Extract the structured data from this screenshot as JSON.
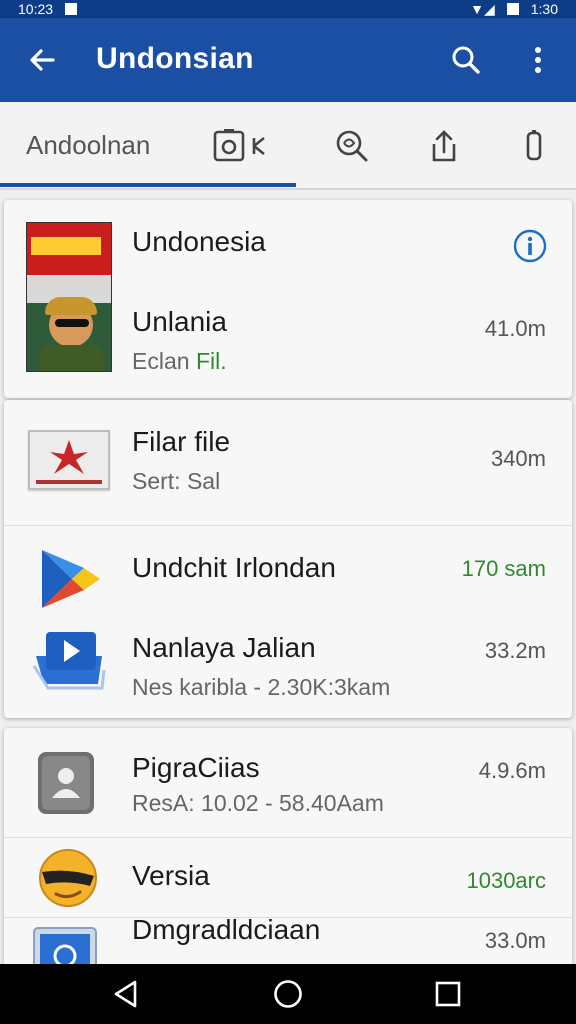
{
  "status_bar": {
    "time_left": "10:23",
    "time_right": "1:30"
  },
  "app_bar": {
    "title": "Undonsian",
    "back_icon": "arrow-back-icon",
    "search_icon": "search-icon",
    "more_icon": "more-vert-icon"
  },
  "tabs": {
    "first_label": "Andoolnan",
    "icons": [
      "camera-icon",
      "search-globe-icon",
      "share-icon",
      "battery-icon"
    ]
  },
  "colors": {
    "primary": "#1a4fa3",
    "status": "#0d3d86",
    "green": "#2f8a2f",
    "info": "#1a6fc8"
  },
  "card1": {
    "header": {
      "title": "Undonesia",
      "icon": "info-icon"
    },
    "item": {
      "title": "Unlania",
      "subtitle_plain": "Eclan ",
      "subtitle_green": "Fil.",
      "value": "41.0m"
    }
  },
  "card2": {
    "items": [
      {
        "title": "Filar file",
        "subtitle": "Sert: Sal",
        "value": "340m"
      },
      {
        "title": "Undchit Irlondan",
        "value": "170 sam"
      },
      {
        "title": "Nanlaya Jalian",
        "subtitle": "Nes karibla - 2.30K:3kam",
        "value": "33.2m"
      }
    ]
  },
  "card3": {
    "items": [
      {
        "title": "PigraCiias",
        "subtitle": "ResA: 10.02 - 58.40Aam",
        "value": "4.9.6m"
      },
      {
        "title": "Versia",
        "value": "1030arc"
      },
      {
        "title": "Dmgradldciaan",
        "value": "33.0m"
      }
    ]
  },
  "nav_bar": {
    "icons": [
      "nav-back-icon",
      "nav-home-icon",
      "nav-recents-icon"
    ]
  }
}
